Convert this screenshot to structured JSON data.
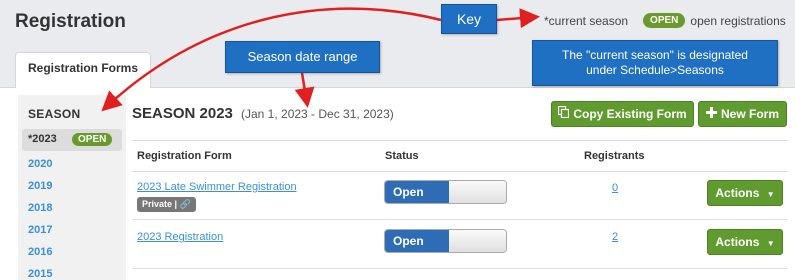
{
  "header": {
    "title": "Registration"
  },
  "key": {
    "current_season_text": "*current season",
    "open_badge": "OPEN",
    "open_text": "open registrations"
  },
  "tabs": [
    {
      "label": "Registration Forms",
      "active": true
    }
  ],
  "sidebar": {
    "heading": "SEASON",
    "current": {
      "label": "*2023",
      "badge": "OPEN"
    },
    "seasons": [
      "2020",
      "2019",
      "2018",
      "2017",
      "2016",
      "2015"
    ]
  },
  "main": {
    "season_title": "SEASON 2023",
    "date_range": "(Jan 1, 2023 - Dec 31, 2023)",
    "copy_button": "Copy Existing Form",
    "new_button": "New Form"
  },
  "table": {
    "headers": [
      "Registration Form",
      "Status",
      "Registrants"
    ],
    "rows": [
      {
        "name": "2023 Late Swimmer Registration",
        "badge": "Private |",
        "status": "Open",
        "registrants": "0",
        "actions": "Actions"
      },
      {
        "name": "2023 Registration",
        "status": "Open",
        "registrants": "2",
        "actions": "Actions"
      }
    ]
  },
  "annotations": {
    "key": "Key",
    "season_range": "Season date range",
    "current_season_line1": "The \"current season\" is designated",
    "current_season_line2": "under Schedule>Seasons"
  },
  "colors": {
    "accent_green": "#5f9b2e",
    "link_blue": "#3a8fd6",
    "toggle_blue": "#2e6db5",
    "callout_blue": "#1f6fc3",
    "arrow_red": "#e02020"
  }
}
